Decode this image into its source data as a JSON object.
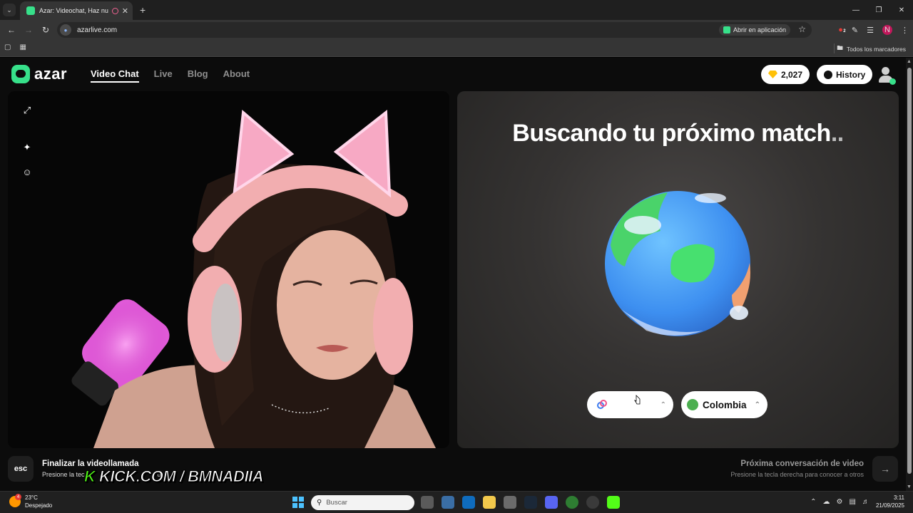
{
  "browser": {
    "tab_title": "Azar: Videochat, Haz nuevos amigos",
    "url": "azarlive.com",
    "open_in_app": "Abrir en aplicación",
    "bookmarks_all": "Todos los marcadores",
    "profile_initial": "N",
    "extension_badge": "2"
  },
  "site": {
    "logo": "azar",
    "nav": [
      {
        "label": "Video Chat",
        "active": true
      },
      {
        "label": "Live",
        "active": false
      },
      {
        "label": "Blog",
        "active": false
      },
      {
        "label": "About",
        "active": false
      }
    ],
    "gems": "2,027",
    "history_label": "History",
    "accent_color": "#37e08a"
  },
  "match": {
    "title": "Buscando tu próximo match",
    "dots": "..",
    "country": "Colombia"
  },
  "footer": {
    "esc_key": "esc",
    "end_title": "Finalizar la videollamada",
    "end_sub": "Presione la tec",
    "end_sub_tail": "d",
    "overlay_k": "K",
    "overlay_text": "KICK.COM / BMNADIIA",
    "next_title": "Próxima conversación de video",
    "next_sub": "Presione la tecla derecha para conocer a otros",
    "next_icon": "arrow-right-icon"
  },
  "taskbar": {
    "temp": "23°C",
    "weather": "Despejado",
    "weather_badge": "4",
    "search_placeholder": "Buscar",
    "time": "3:11",
    "date": "21/09/2025"
  }
}
